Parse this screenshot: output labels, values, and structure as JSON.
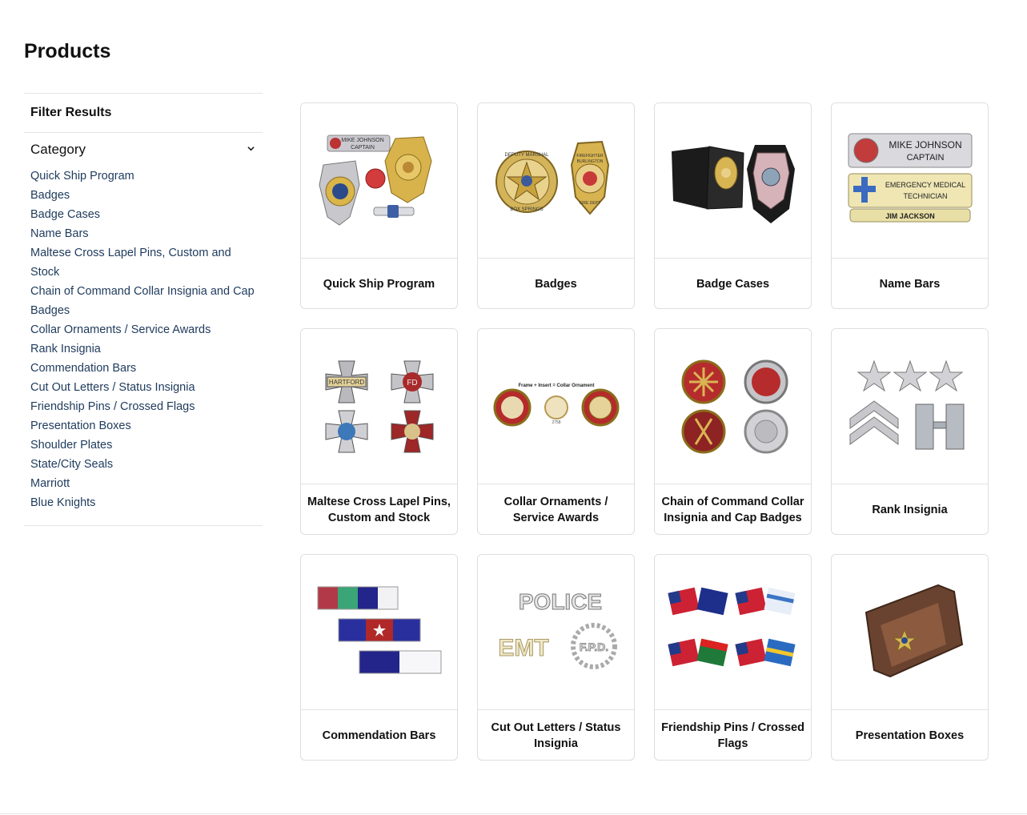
{
  "page": {
    "title": "Products"
  },
  "sidebar": {
    "filter_heading": "Filter Results",
    "category_heading": "Category",
    "categories": [
      "Quick Ship Program",
      "Badges",
      "Badge Cases",
      "Name Bars",
      "Maltese Cross Lapel Pins, Custom and Stock",
      "Chain of Command Collar Insignia and Cap Badges",
      "Collar Ornaments / Service Awards",
      "Rank Insignia",
      "Commendation Bars",
      "Cut Out Letters / Status Insignia",
      "Friendship Pins / Crossed Flags",
      "Presentation Boxes",
      "Shoulder Plates",
      "State/City Seals",
      "Marriott",
      "Blue Knights"
    ]
  },
  "products": [
    {
      "name": "Quick Ship Program",
      "image_text": [
        "MIKE JOHNSON",
        "CAPTAIN"
      ]
    },
    {
      "name": "Badges",
      "image_text": [
        "DEPUTY MARSHAL",
        "BOX SPRINGS",
        "FIREFIGHTER",
        "BURLINGTON",
        "FIRE DEPT"
      ]
    },
    {
      "name": "Badge Cases",
      "image_text": []
    },
    {
      "name": "Name Bars",
      "image_text": [
        "MIKE JOHNSON",
        "CAPTAIN",
        "EMERGENCY MEDICAL",
        "TECHNICIAN",
        "JIM JACKSON"
      ]
    },
    {
      "name": "Maltese Cross Lapel Pins, Custom and Stock",
      "image_text": [
        "HARTFORD",
        "FD"
      ]
    },
    {
      "name": "Collar Ornaments / Service Awards",
      "image_text": [
        "Frame + Insert = Collar Ornament",
        "2758"
      ]
    },
    {
      "name": "Chain of Command Collar Insignia and Cap Badges",
      "image_text": []
    },
    {
      "name": "Rank Insignia",
      "image_text": []
    },
    {
      "name": "Commendation Bars",
      "image_text": []
    },
    {
      "name": "Cut Out Letters / Status Insignia",
      "image_text": [
        "POLICE",
        "EMT",
        "F.P.D."
      ]
    },
    {
      "name": "Friendship Pins / Crossed Flags",
      "image_text": []
    },
    {
      "name": "Presentation Boxes",
      "image_text": []
    }
  ]
}
